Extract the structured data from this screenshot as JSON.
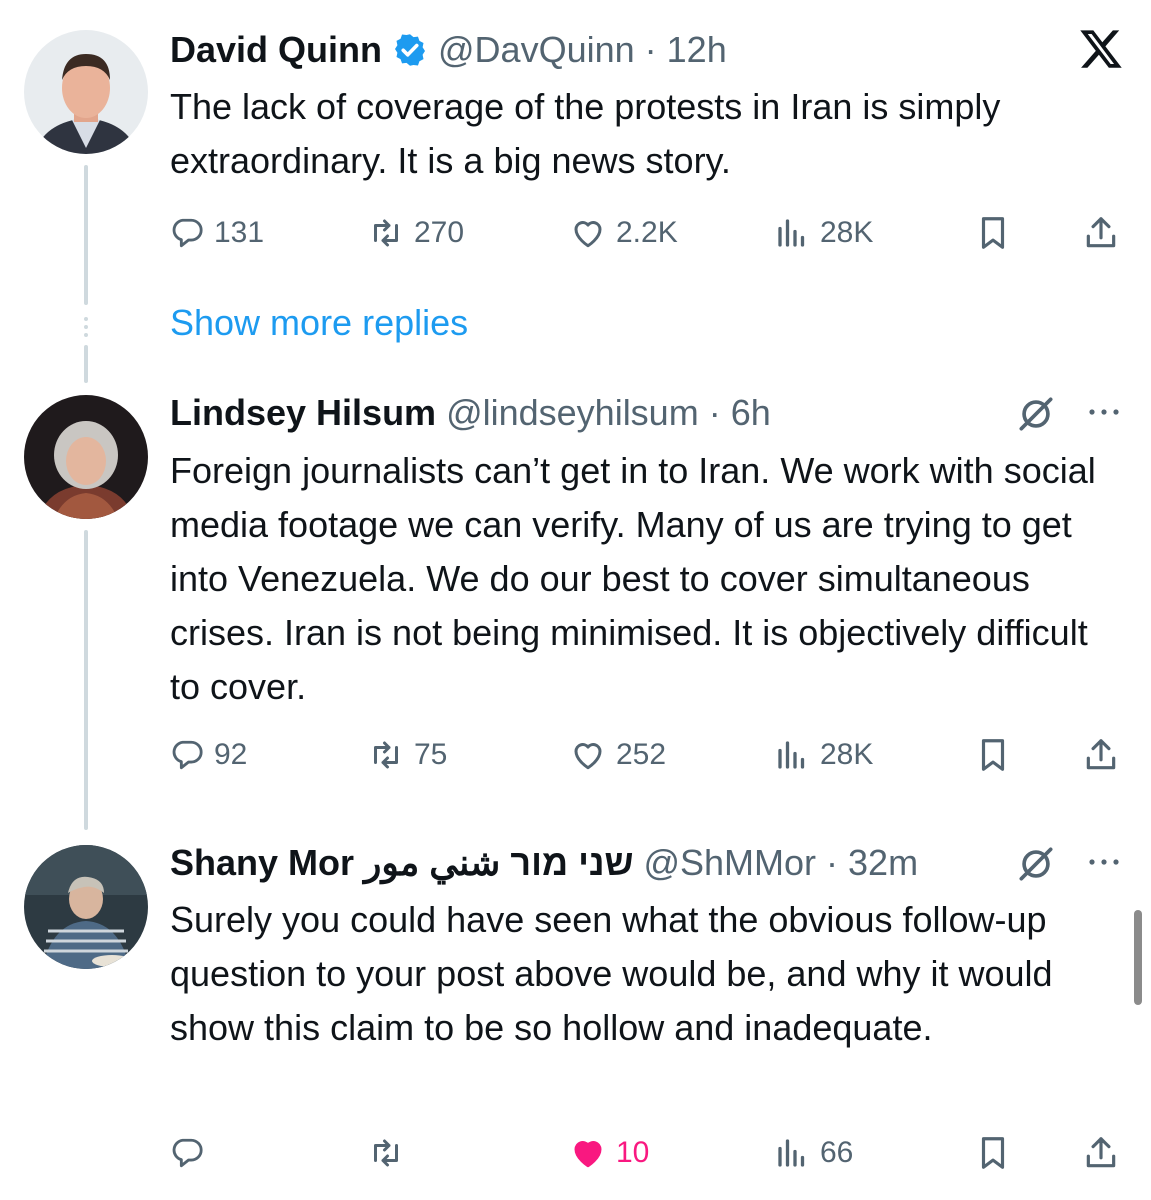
{
  "tweets": [
    {
      "name": "David Quinn",
      "verified": true,
      "handle": "@DavQuinn",
      "time": "12h",
      "text": "The lack of coverage of the protests in Iran is simply extraordinary. It is a big news story.",
      "replies": "131",
      "reposts": "270",
      "likes": "2.2K",
      "views": "28K",
      "liked": false
    },
    {
      "name": "Lindsey Hilsum",
      "verified": false,
      "handle": "@lindseyhilsum",
      "time": "6h",
      "text": "Foreign journalists can’t get in to Iran. We work with social media footage we can verify. Many of us are trying to get into Venezuela. We do our best to cover simultaneous crises. Iran is not being minimised. It is objectively difficult to cover.",
      "replies": "92",
      "reposts": "75",
      "likes": "252",
      "views": "28K",
      "liked": false
    },
    {
      "name": "Shany Mor שני מור شني مور",
      "verified": false,
      "handle": "@ShMMor",
      "time": "32m",
      "text": "Surely you could have seen what the obvious follow-up question to your post above would be, and why it would show this claim to be so hollow and inadequate.",
      "replies": "",
      "reposts": "",
      "likes": "10",
      "views": "66",
      "liked": true
    }
  ],
  "separator": "·",
  "show_more_replies": "Show more replies",
  "colors": {
    "like_active": "#f91880",
    "link": "#1d9bf0",
    "muted": "#536471",
    "verified": "#1d9bf0"
  }
}
